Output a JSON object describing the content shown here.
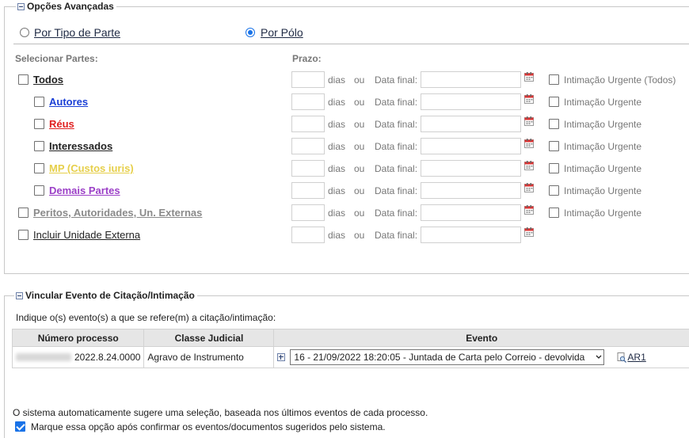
{
  "advanced": {
    "legend": "Opções Avançadas",
    "mode_type_label": "Por Tipo de Parte",
    "mode_polo_label": "Por Pólo",
    "select_parts_label": "Selecionar Partes:",
    "prazo_label": "Prazo:",
    "days_label": "dias",
    "or_label": "ou",
    "date_label": "Data final:",
    "rows": [
      {
        "label": "Todos",
        "color": "#222222",
        "urgent": "Intimação Urgente (Todos)"
      },
      {
        "label": "Autores",
        "color": "#1a3fd6",
        "urgent": "Intimação Urgente"
      },
      {
        "label": "Réus",
        "color": "#e02020",
        "urgent": "Intimação Urgente"
      },
      {
        "label": "Interessados",
        "color": "#222222",
        "urgent": "Intimação Urgente"
      },
      {
        "label": "MP (Custos iuris)",
        "color": "#e6cf4a",
        "urgent": "Intimação Urgente"
      },
      {
        "label": "Demais Partes",
        "color": "#9b3fc7",
        "urgent": "Intimação Urgente"
      },
      {
        "label": "Peritos, Autoridades, Un. Externas",
        "color": "#8a8a8a",
        "urgent": "Intimação Urgente"
      },
      {
        "label": "Incluir Unidade Externa",
        "color": "#222222",
        "urgent": ""
      }
    ]
  },
  "event": {
    "legend": "Vincular Evento de Citação/Intimação",
    "instruction": "Indique o(s) evento(s) a que se refere(m) a citação/intimação:",
    "col_process": "Número processo",
    "col_class": "Classe Judicial",
    "col_event": "Evento",
    "row": {
      "process_suffix": "2022.8.24.0000",
      "class": "Agravo de Instrumento",
      "event_selected": "16 - 21/09/2022 18:20:05 - Juntada de Carta pelo Correio - devolvida",
      "doc_link": "AR1"
    }
  },
  "footer": {
    "note": "O sistema automaticamente sugere uma seleção, baseada nos últimos eventos de cada processo.",
    "confirm_label": "Marque essa opção após confirmar os eventos/documentos sugeridos pelo sistema."
  }
}
